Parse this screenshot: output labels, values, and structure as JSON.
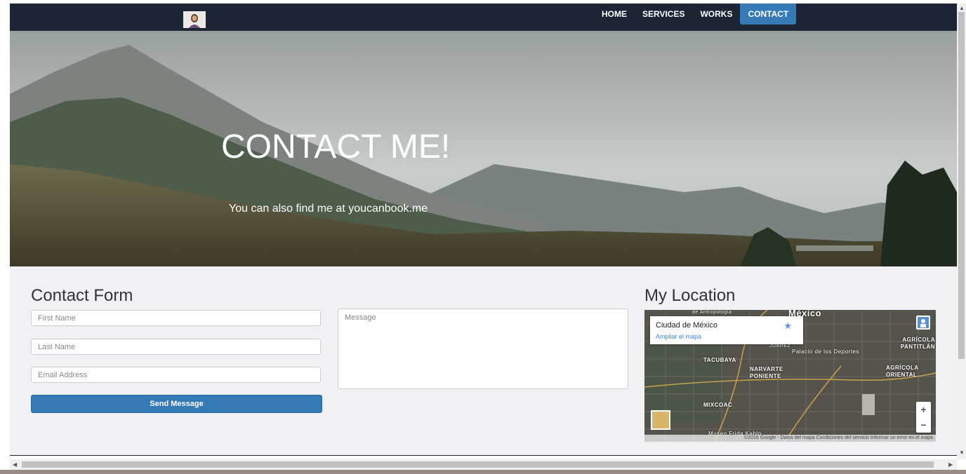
{
  "nav": {
    "items": [
      "HOME",
      "SERVICES",
      "WORKS",
      "CONTACT"
    ],
    "active": "CONTACT"
  },
  "hero": {
    "title": "CONTACT ME!",
    "subtitle": "You can also find me at youcanbook.me"
  },
  "contact": {
    "title": "Contact Form",
    "first_name_placeholder": "First Name",
    "last_name_placeholder": "Last Name",
    "email_placeholder": "Email Address",
    "message_placeholder": "Message",
    "send_label": "Send Message"
  },
  "location": {
    "title": "My Location",
    "place": "Ciudad de México",
    "enlarge_link": "Ampliar el mapa",
    "labels": [
      "México",
      "TACUBAYA",
      "NARVARTE PONIENTE",
      "MIXCOAC",
      "AGRÍCOLA PANTITLÁN",
      "AGRÍCOLA ORIENTAL",
      "Palacio de los Deportes",
      "de Antropología",
      "JUÁREZ",
      "Museo Frida Kahlo"
    ],
    "footer": "©2016 Google - Datos del mapa   Condiciones del servicio   Informar un error en el mapa",
    "zoom_in": "+",
    "zoom_out": "−"
  },
  "colors": {
    "navbar": "#1c2533",
    "accent": "#337ab7",
    "page_bg": "#f0f0f5"
  }
}
